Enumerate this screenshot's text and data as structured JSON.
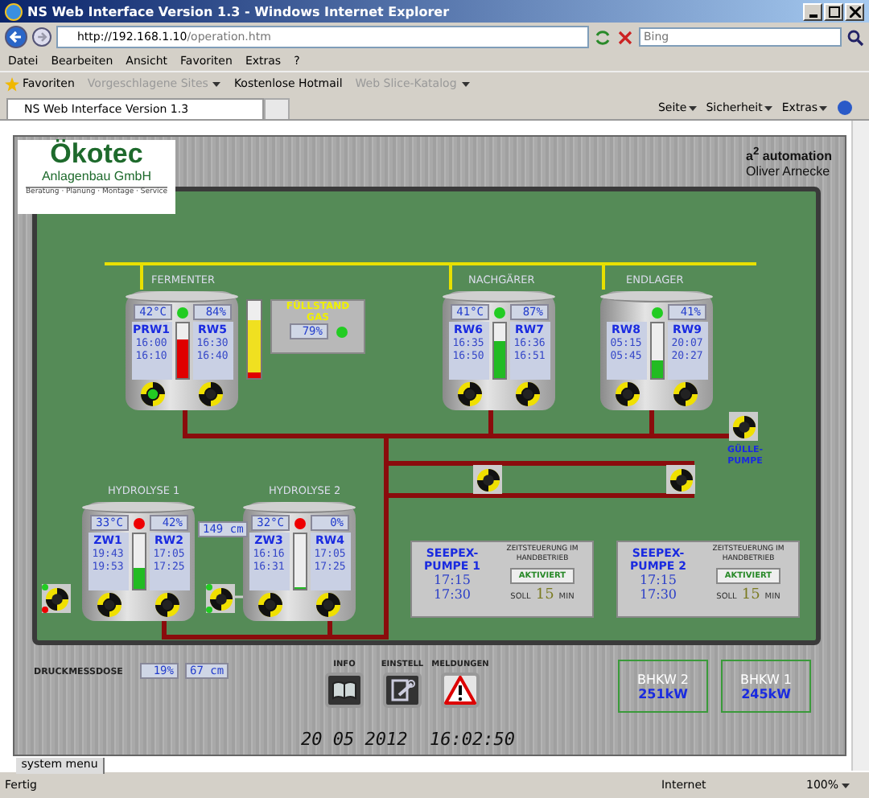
{
  "window": {
    "title": "NS Web Interface Version 1.3 - Windows Internet Explorer"
  },
  "browser": {
    "address_host": "http://192.168.1.10",
    "address_path": "/operation.htm",
    "search_placeholder": "Bing",
    "menu": [
      "Datei",
      "Bearbeiten",
      "Ansicht",
      "Favoriten",
      "Extras",
      "?"
    ],
    "favorites": [
      {
        "label": "Favoriten",
        "kind": "star"
      },
      {
        "label": "Vorgeschlagene Sites",
        "kind": "dropdown",
        "disabled": true
      },
      {
        "label": "Kostenlose Hotmail",
        "kind": "link",
        "disabled": false
      },
      {
        "label": "Web Slice-Katalog",
        "kind": "dropdown",
        "disabled": true
      }
    ],
    "tab_title": "NS Web Interface Version 1.3",
    "commands": [
      "Seite",
      "Sicherheit",
      "Extras"
    ]
  },
  "header": {
    "logo_name": "Ökotec",
    "logo_sub": "Anlagenbau GmbH",
    "logo_tagline": "Beratung · Planung · Montage · Service",
    "brand": "a$^{2}$ automation",
    "brand_owner": "Oliver Arnecke"
  },
  "tanks": [
    {
      "label": "FERMENTER",
      "temperature": "42°C",
      "fill": "84%",
      "color": "#22cc22",
      "left": {
        "name": "PRW1",
        "times": [
          "16:00",
          "16:10"
        ]
      },
      "right": {
        "name": "RW5",
        "times": [
          "16:30",
          "16:40"
        ]
      },
      "gauge": {
        "level": 0.72,
        "color": "#e00000"
      },
      "pumps": [
        {
          "running": true
        },
        {
          "running": false
        }
      ]
    },
    {
      "label": "NACHGÄRER",
      "temperature": "41°C",
      "fill": "87%",
      "color": "#22cc22",
      "left": {
        "name": "RW6",
        "times": [
          "16:35",
          "16:50"
        ]
      },
      "right": {
        "name": "RW7",
        "times": [
          "16:36",
          "16:51"
        ]
      },
      "gauge": {
        "level": 0.68,
        "color": "#22bb22"
      },
      "pumps": [
        {
          "running": false
        },
        {
          "running": false
        }
      ]
    },
    {
      "label": "ENDLAGER",
      "fill": "41%",
      "color": "#22cc22",
      "left": {
        "name": "RW8",
        "times": [
          "05:15",
          "05:45"
        ]
      },
      "right": {
        "name": "RW9",
        "times": [
          "20:07",
          "20:27"
        ]
      },
      "gauge": {
        "level": 0.32,
        "color": "#22bb22"
      },
      "pumps": [
        {
          "running": false
        },
        {
          "running": false
        }
      ]
    },
    {
      "label": "HYDROLYSE 1",
      "temperature": "33°C",
      "fill": "42%",
      "color": "#ee0000",
      "left": {
        "name": "ZW1",
        "times": [
          "19:43",
          "19:53"
        ]
      },
      "right": {
        "name": "RW2",
        "times": [
          "17:05",
          "17:25"
        ]
      },
      "gauge": {
        "level": 0.38,
        "color": "#22bb22"
      },
      "pumps": [
        {
          "running": false
        },
        {
          "running": false
        }
      ]
    },
    {
      "label": "HYDROLYSE 2",
      "temperature": "32°C",
      "fill": "0%",
      "color": "#ee0000",
      "left": {
        "name": "ZW3",
        "times": [
          "16:16",
          "16:31"
        ]
      },
      "right": {
        "name": "RW4",
        "times": [
          "17:05",
          "17:25"
        ]
      },
      "gauge": {
        "level": 0.03,
        "color": "#22bb22"
      },
      "pumps": [
        {
          "running": false
        },
        {
          "running": false
        }
      ]
    }
  ],
  "gas_level": {
    "title": "FÜLLSTAND GAS",
    "value": "79%",
    "color": "#22cc22",
    "level": 0.75
  },
  "hydrolyse_level": "149 cm",
  "inlet_pumps": [
    {
      "dots": [
        {
          "color": "#22cc22"
        },
        {
          "color": "#ee0000"
        }
      ]
    },
    {
      "dots": [
        {
          "color": "#22cc22"
        },
        {
          "color": "#22cc22"
        }
      ]
    }
  ],
  "slurry_pump_label": "GÜLLE-PUMPE",
  "seepex": [
    {
      "name": "SEEPEX-PUMPE 1",
      "times": [
        "17:15",
        "17:30"
      ],
      "mode": "ZEITSTEUERUNG IM HANDBETRIEB",
      "state": "AKTIVIERT",
      "soll_label": "SOLL",
      "soll": "15",
      "unit": "MIN"
    },
    {
      "name": "SEEPEX-PUMPE 2",
      "times": [
        "17:15",
        "17:30"
      ],
      "mode": "ZEITSTEUERUNG IM HANDBETRIEB",
      "state": "AKTIVIERT",
      "soll_label": "SOLL",
      "soll": "15",
      "unit": "MIN"
    }
  ],
  "pressure": {
    "label": "DRUCKMESSDOSE",
    "percent": "19%",
    "height": "67 cm"
  },
  "nav": [
    {
      "label": "INFO",
      "kind": "book"
    },
    {
      "label": "EINSTELL",
      "kind": "tools"
    },
    {
      "label": "MELDUNGEN",
      "kind": "warning"
    }
  ],
  "date": "20 05 2012",
  "time": "16:02:50",
  "engines": [
    {
      "name": "BHKW 2",
      "power": "251kW"
    },
    {
      "name": "BHKW 1",
      "power": "245kW"
    }
  ],
  "system_menu": "system menu",
  "status_bar": {
    "text": "Fertig",
    "zone": "Internet",
    "zoom": "100%"
  }
}
